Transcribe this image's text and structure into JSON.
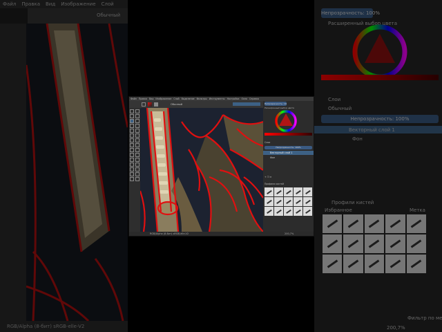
{
  "menu": [
    "Файл",
    "Правка",
    "Вид",
    "Изображение",
    "Слой",
    "Выделение",
    "Фильтры",
    "Инструменты",
    "Настройка",
    "Окно",
    "Справка"
  ],
  "tool_options": {
    "blend_mode": "Обычный"
  },
  "dockers": {
    "opacity_button": "Непрозрачность: 100%",
    "color_selector_title": "Расширенный выбор цвета",
    "layers_title": "Слои",
    "layers_blend_mode": "Обычный",
    "layers_opacity": "Непрозрачность: 100%",
    "layers": [
      {
        "name": "Векторный слой 1",
        "selected": true
      },
      {
        "name": "Фон",
        "selected": false
      }
    ],
    "brush_presets_title": "Профили кистей",
    "brush_tag": "Избранное",
    "brush_search_label": "Метка",
    "filter_checkbox": "Фильтр по меткам"
  },
  "status": {
    "left_text": "RGB/Alpha (8-бит)  sRGB-elle-V2",
    "zoom": "200,7%"
  },
  "colors": {
    "accent": "#3d6185",
    "stroke_red": "#e01010",
    "gold": "#b59a62"
  },
  "icons": [
    "brush-tool-icon",
    "selection-tool-icon",
    "layer-visible-icon",
    "lock-icon",
    "add-icon",
    "delete-icon",
    "settings-icon"
  ]
}
